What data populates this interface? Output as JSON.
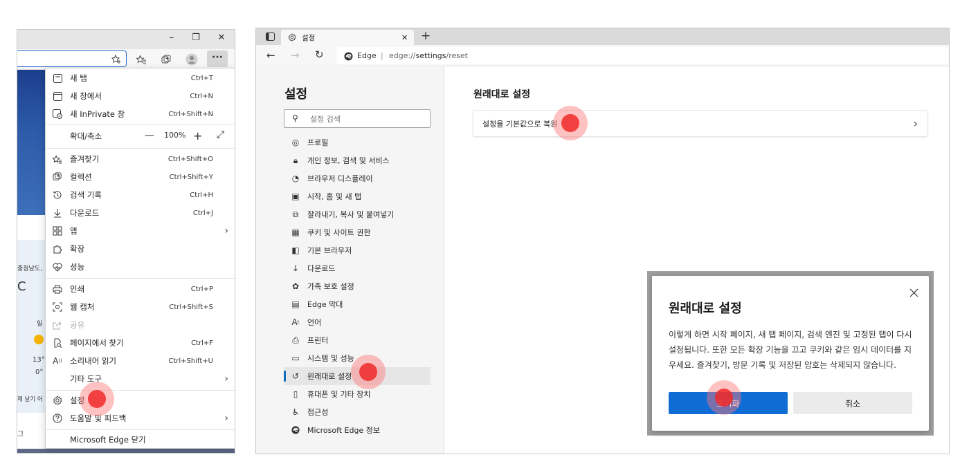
{
  "left_window": {
    "controls": {
      "minimize": "–",
      "restore": "❐",
      "close": "✕"
    },
    "toolbar_icons": [
      "favorites-add-icon",
      "favorites-icon",
      "collections-icon",
      "profile-icon"
    ],
    "more_button": "···",
    "background_texts": {
      "region": "충청남도,",
      "temp_unit": "C",
      "day": "일",
      "high": "13°",
      "low": "0°",
      "link": "제 날기 어",
      "bottom": "그"
    },
    "menu": {
      "items": [
        {
          "label": "새 탭",
          "shortcut": "Ctrl+T",
          "icon": "new-tab-icon"
        },
        {
          "label": "새 창에서",
          "shortcut": "Ctrl+N",
          "icon": "new-window-icon"
        },
        {
          "label": "새 InPrivate 창",
          "shortcut": "Ctrl+Shift+N",
          "icon": "inprivate-icon"
        },
        {
          "label": "확대/축소",
          "icon": ""
        },
        {
          "label": "즐겨찾기",
          "shortcut": "Ctrl+Shift+O",
          "icon": "favorites-icon"
        },
        {
          "label": "컬렉션",
          "shortcut": "Ctrl+Shift+Y",
          "icon": "collections-icon"
        },
        {
          "label": "검색 기록",
          "shortcut": "Ctrl+H",
          "icon": "history-icon"
        },
        {
          "label": "다운로드",
          "shortcut": "Ctrl+J",
          "icon": "download-icon"
        },
        {
          "label": "앱",
          "icon": "apps-icon"
        },
        {
          "label": "확장",
          "icon": "extensions-icon"
        },
        {
          "label": "성능",
          "icon": "performance-icon"
        },
        {
          "label": "인쇄",
          "shortcut": "Ctrl+P",
          "icon": "print-icon"
        },
        {
          "label": "웹 캡처",
          "shortcut": "Ctrl+Shift+S",
          "icon": "web-capture-icon"
        },
        {
          "label": "공유",
          "icon": "share-icon"
        },
        {
          "label": "페이지에서 찾기",
          "shortcut": "Ctrl+F",
          "icon": "find-icon"
        },
        {
          "label": "소리내어 읽기",
          "shortcut": "Ctrl+Shift+U",
          "icon": "read-aloud-icon"
        },
        {
          "label": "기타 도구",
          "icon": ""
        },
        {
          "label": "설정",
          "icon": "settings-icon"
        },
        {
          "label": "도움말 및 피드백",
          "icon": "help-icon"
        },
        {
          "label": "Microsoft Edge 닫기",
          "icon": ""
        }
      ],
      "zoom": {
        "minus": "—",
        "value": "100%",
        "plus": "+",
        "fullscreen": "⤢"
      }
    }
  },
  "right_window": {
    "tab_title": "설정",
    "new_tab": "+",
    "tab_close": "✕",
    "address": {
      "site": "Edge",
      "url_prefix": "edge://",
      "url_bold": "settings",
      "url_suffix": "/reset"
    },
    "sidebar": {
      "title": "설정",
      "search_placeholder": "설정 검색",
      "items": [
        {
          "label": "프로필",
          "icon": "profile-icon"
        },
        {
          "label": "개인 정보, 검색 및 서비스",
          "icon": "privacy-lock-icon"
        },
        {
          "label": "브라우저 디스플레이",
          "icon": "appearance-icon"
        },
        {
          "label": "시작, 홈 및 새 탭",
          "icon": "start-home-icon"
        },
        {
          "label": "잘라내기, 복사 및 붙여넣기",
          "icon": "share-copy-paste-icon"
        },
        {
          "label": "쿠키 및 사이트 권한",
          "icon": "site-permissions-icon"
        },
        {
          "label": "기본 브라우저",
          "icon": "default-browser-icon"
        },
        {
          "label": "다운로드",
          "icon": "download-icon"
        },
        {
          "label": "가족 보호 설정",
          "icon": "family-icon"
        },
        {
          "label": "Edge 막대",
          "icon": "edge-bar-icon"
        },
        {
          "label": "언어",
          "icon": "language-icon"
        },
        {
          "label": "프린터",
          "icon": "printer-icon"
        },
        {
          "label": "시스템 및 성능",
          "icon": "system-icon"
        },
        {
          "label": "원래대로 설정",
          "icon": "reset-icon"
        },
        {
          "label": "휴대폰 및 기타 장치",
          "icon": "phone-icon"
        },
        {
          "label": "접근성",
          "icon": "accessibility-icon"
        },
        {
          "label": "Microsoft Edge 정보",
          "icon": "edge-logo-icon"
        }
      ]
    },
    "main": {
      "title": "원래대로 설정",
      "reset_item": "설정을 기본값으로 복원"
    },
    "dialog": {
      "title": "원래대로 설정",
      "body": "이렇게 하면 시작 페이지, 새 탭 페이지, 검색 엔진 및 고정된 탭이 다시 설정됩니다. 또한 모든 확장 기능을 끄고 쿠키와 같은 임시 데이터를 지우세요. 즐겨찾기, 방문 기록 및 저장된 암호는 삭제되지 않습니다.",
      "confirm": "초기화",
      "cancel": "취소"
    }
  }
}
